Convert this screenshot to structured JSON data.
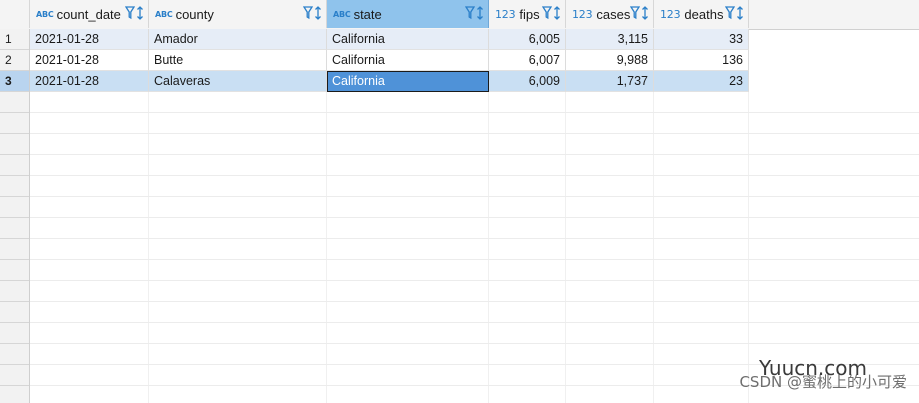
{
  "columns": [
    {
      "name": "count_date",
      "type_label": "ABC",
      "align": "left"
    },
    {
      "name": "county",
      "type_label": "ABC",
      "align": "left"
    },
    {
      "name": "state",
      "type_label": "ABC",
      "align": "left"
    },
    {
      "name": "fips",
      "type_label": "123",
      "align": "right"
    },
    {
      "name": "cases",
      "type_label": "123",
      "align": "right"
    },
    {
      "name": "deaths",
      "type_label": "123",
      "align": "right"
    }
  ],
  "rows": [
    {
      "num": "1",
      "cells": [
        "2021-01-28",
        "Amador",
        "California",
        "6,005",
        "3,115",
        "33"
      ]
    },
    {
      "num": "2",
      "cells": [
        "2021-01-28",
        "Butte",
        "California",
        "6,007",
        "9,988",
        "136"
      ]
    },
    {
      "num": "3",
      "cells": [
        "2021-01-28",
        "Calaveras",
        "California",
        "6,009",
        "1,737",
        "23"
      ]
    }
  ],
  "selection": {
    "selected_column": "state",
    "current_row": "3"
  },
  "watermark": {
    "text": "CSDN @蜜桃上的小可爱",
    "site": "Yuucn.com"
  },
  "colors": {
    "header_selected": "#8fc3ec",
    "focused_cell": "#4f92d8",
    "type_badge": "#2a7fc9"
  }
}
